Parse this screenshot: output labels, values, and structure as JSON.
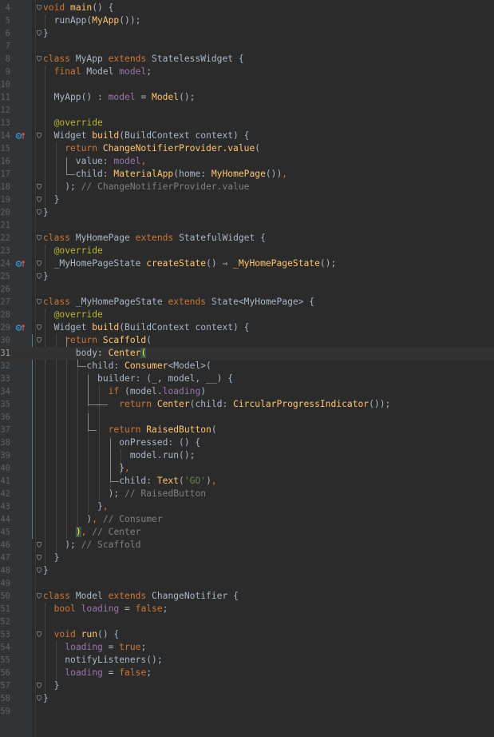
{
  "editor": {
    "language": "dart",
    "first_line_number": 4,
    "current_line": 31,
    "lines": [
      {
        "n": "4",
        "t": [
          [
            "kw",
            "void "
          ],
          [
            "fn",
            "main"
          ],
          [
            "plain",
            "() {"
          ]
        ]
      },
      {
        "n": "5",
        "t": [
          [
            "plain",
            "  runApp("
          ],
          [
            "fn",
            "MyApp"
          ],
          [
            "plain",
            "());"
          ]
        ]
      },
      {
        "n": "6",
        "t": [
          [
            "plain",
            "}"
          ]
        ]
      },
      {
        "n": "7",
        "t": []
      },
      {
        "n": "8",
        "t": [
          [
            "kw",
            "class "
          ],
          [
            "plain",
            "MyApp "
          ],
          [
            "kw",
            "extends "
          ],
          [
            "plain",
            "StatelessWidget {"
          ]
        ]
      },
      {
        "n": "9",
        "t": [
          [
            "plain",
            "  "
          ],
          [
            "kw",
            "final "
          ],
          [
            "plain",
            "Model "
          ],
          [
            "fld",
            "model"
          ],
          [
            "plain",
            ";"
          ]
        ]
      },
      {
        "n": "10",
        "t": []
      },
      {
        "n": "11",
        "t": [
          [
            "plain",
            "  MyApp() : "
          ],
          [
            "fld",
            "model "
          ],
          [
            "plain",
            "= "
          ],
          [
            "fn",
            "Model"
          ],
          [
            "plain",
            "();"
          ]
        ]
      },
      {
        "n": "12",
        "t": []
      },
      {
        "n": "13",
        "t": [
          [
            "ann",
            "  @override"
          ]
        ]
      },
      {
        "n": "14",
        "t": [
          [
            "plain",
            "  Widget "
          ],
          [
            "fn",
            "build"
          ],
          [
            "plain",
            "(BuildContext context) {"
          ]
        ]
      },
      {
        "n": "15",
        "t": [
          [
            "plain",
            "    "
          ],
          [
            "kw",
            "return "
          ],
          [
            "fn",
            "ChangeNotifierProvider.value"
          ],
          [
            "plain",
            "("
          ]
        ]
      },
      {
        "n": "16",
        "t": [
          [
            "plain",
            "      value: "
          ],
          [
            "fld",
            "model"
          ],
          [
            "kw",
            ","
          ]
        ]
      },
      {
        "n": "17",
        "t": [
          [
            "plain",
            "      child: "
          ],
          [
            "fn",
            "MaterialApp"
          ],
          [
            "plain",
            "(home: "
          ],
          [
            "fn",
            "MyHomePage"
          ],
          [
            "plain",
            "())"
          ],
          [
            "kw",
            ","
          ]
        ]
      },
      {
        "n": "18",
        "t": [
          [
            "plain",
            "    ); "
          ],
          [
            "cmt",
            "// ChangeNotifierProvider.value"
          ]
        ]
      },
      {
        "n": "19",
        "t": [
          [
            "plain",
            "  }"
          ]
        ]
      },
      {
        "n": "20",
        "t": [
          [
            "plain",
            "}"
          ]
        ]
      },
      {
        "n": "21",
        "t": []
      },
      {
        "n": "22",
        "t": [
          [
            "kw",
            "class "
          ],
          [
            "plain",
            "MyHomePage "
          ],
          [
            "kw",
            "extends "
          ],
          [
            "plain",
            "StatefulWidget {"
          ]
        ]
      },
      {
        "n": "23",
        "t": [
          [
            "ann",
            "  @override"
          ]
        ]
      },
      {
        "n": "24",
        "t": [
          [
            "plain",
            "  _MyHomePageState "
          ],
          [
            "fn",
            "createState"
          ],
          [
            "plain",
            "() ⇒ "
          ],
          [
            "fn",
            "_MyHomePageState"
          ],
          [
            "plain",
            "();"
          ]
        ]
      },
      {
        "n": "25",
        "t": [
          [
            "plain",
            "}"
          ]
        ]
      },
      {
        "n": "26",
        "t": []
      },
      {
        "n": "27",
        "t": [
          [
            "kw",
            "class "
          ],
          [
            "plain",
            "_MyHomePageState "
          ],
          [
            "kw",
            "extends "
          ],
          [
            "plain",
            "State<MyHomePage> {"
          ]
        ]
      },
      {
        "n": "28",
        "t": [
          [
            "ann",
            "  @override"
          ]
        ]
      },
      {
        "n": "29",
        "t": [
          [
            "plain",
            "  Widget "
          ],
          [
            "fn",
            "build"
          ],
          [
            "plain",
            "(BuildContext context) {"
          ]
        ]
      },
      {
        "n": "30",
        "t": [
          [
            "plain",
            "    "
          ],
          [
            "kw",
            "return "
          ],
          [
            "fn",
            "Scaffold"
          ],
          [
            "plain",
            "("
          ]
        ]
      },
      {
        "n": "31",
        "t": [
          [
            "plain",
            "      body: "
          ],
          [
            "fn",
            "Center"
          ],
          [
            "hl",
            "("
          ]
        ]
      },
      {
        "n": "32",
        "t": [
          [
            "plain",
            "        child: "
          ],
          [
            "fn",
            "Consumer"
          ],
          [
            "plain",
            "<Model>("
          ]
        ]
      },
      {
        "n": "33",
        "t": [
          [
            "plain",
            "          builder: (_, model, __) {"
          ]
        ]
      },
      {
        "n": "34",
        "t": [
          [
            "plain",
            "            "
          ],
          [
            "kw",
            "if "
          ],
          [
            "plain",
            "(model."
          ],
          [
            "fld",
            "loading"
          ],
          [
            "plain",
            ")"
          ]
        ]
      },
      {
        "n": "35",
        "t": [
          [
            "plain",
            "              "
          ],
          [
            "kw",
            "return "
          ],
          [
            "fn",
            "Center"
          ],
          [
            "plain",
            "(child: "
          ],
          [
            "fn",
            "CircularProgressIndicator"
          ],
          [
            "plain",
            "());"
          ]
        ]
      },
      {
        "n": "36",
        "t": []
      },
      {
        "n": "37",
        "t": [
          [
            "plain",
            "            "
          ],
          [
            "kw",
            "return "
          ],
          [
            "fn",
            "RaisedButton"
          ],
          [
            "plain",
            "("
          ]
        ]
      },
      {
        "n": "38",
        "t": [
          [
            "plain",
            "              onPressed: () {"
          ]
        ]
      },
      {
        "n": "39",
        "t": [
          [
            "plain",
            "                model.run();"
          ]
        ]
      },
      {
        "n": "40",
        "t": [
          [
            "plain",
            "              }"
          ],
          [
            "kw",
            ","
          ]
        ]
      },
      {
        "n": "41",
        "t": [
          [
            "plain",
            "              child: "
          ],
          [
            "fn",
            "Text"
          ],
          [
            "plain",
            "("
          ],
          [
            "str",
            "'GO'"
          ],
          [
            "plain",
            ")"
          ],
          [
            "kw",
            ","
          ]
        ]
      },
      {
        "n": "42",
        "t": [
          [
            "plain",
            "            ); "
          ],
          [
            "cmt",
            "// RaisedButton"
          ]
        ]
      },
      {
        "n": "43",
        "t": [
          [
            "plain",
            "          }"
          ],
          [
            "kw",
            ","
          ]
        ]
      },
      {
        "n": "44",
        "t": [
          [
            "plain",
            "        )"
          ],
          [
            "kw",
            ", "
          ],
          [
            "cmt",
            "// Consumer"
          ]
        ]
      },
      {
        "n": "45",
        "t": [
          [
            "plain",
            "      "
          ],
          [
            "hl",
            ")"
          ],
          [
            "kw",
            ", "
          ],
          [
            "cmt",
            "// Center"
          ]
        ]
      },
      {
        "n": "46",
        "t": [
          [
            "plain",
            "    ); "
          ],
          [
            "cmt",
            "// Scaffold"
          ]
        ]
      },
      {
        "n": "47",
        "t": [
          [
            "plain",
            "  }"
          ]
        ]
      },
      {
        "n": "48",
        "t": [
          [
            "plain",
            "}"
          ]
        ]
      },
      {
        "n": "49",
        "t": []
      },
      {
        "n": "50",
        "t": [
          [
            "kw",
            "class "
          ],
          [
            "plain",
            "Model "
          ],
          [
            "kw",
            "extends "
          ],
          [
            "plain",
            "ChangeNotifier {"
          ]
        ]
      },
      {
        "n": "51",
        "t": [
          [
            "plain",
            "  "
          ],
          [
            "kw",
            "bool "
          ],
          [
            "fld",
            "loading "
          ],
          [
            "plain",
            "= "
          ],
          [
            "kw",
            "false"
          ],
          [
            "plain",
            ";"
          ]
        ]
      },
      {
        "n": "52",
        "t": []
      },
      {
        "n": "53",
        "t": [
          [
            "plain",
            "  "
          ],
          [
            "kw",
            "void "
          ],
          [
            "fn",
            "run"
          ],
          [
            "plain",
            "() {"
          ]
        ]
      },
      {
        "n": "54",
        "t": [
          [
            "plain",
            "    "
          ],
          [
            "fld",
            "loading "
          ],
          [
            "plain",
            "= "
          ],
          [
            "kw",
            "true"
          ],
          [
            "plain",
            ";"
          ]
        ]
      },
      {
        "n": "55",
        "t": [
          [
            "plain",
            "    notifyListeners();"
          ]
        ]
      },
      {
        "n": "56",
        "t": [
          [
            "plain",
            "    "
          ],
          [
            "fld",
            "loading "
          ],
          [
            "plain",
            "= "
          ],
          [
            "kw",
            "false"
          ],
          [
            "plain",
            ";"
          ]
        ]
      },
      {
        "n": "57",
        "t": [
          [
            "plain",
            "  }"
          ]
        ]
      },
      {
        "n": "58",
        "t": [
          [
            "plain",
            "}"
          ]
        ]
      },
      {
        "n": "59",
        "t": []
      }
    ],
    "gutter_icons": [
      {
        "line": "14",
        "icon": "override-method-icon"
      },
      {
        "line": "24",
        "icon": "override-method-icon"
      },
      {
        "line": "29",
        "icon": "override-method-icon"
      }
    ],
    "colors": {
      "background": "#2b2b2b",
      "gutter": "#313335",
      "keyword": "#cc7832",
      "function": "#ffc66d",
      "field": "#9876aa",
      "string": "#6a8759",
      "annotation": "#bbb529",
      "comment": "#808080",
      "text": "#a9b7c6",
      "line_number": "#606366"
    }
  }
}
